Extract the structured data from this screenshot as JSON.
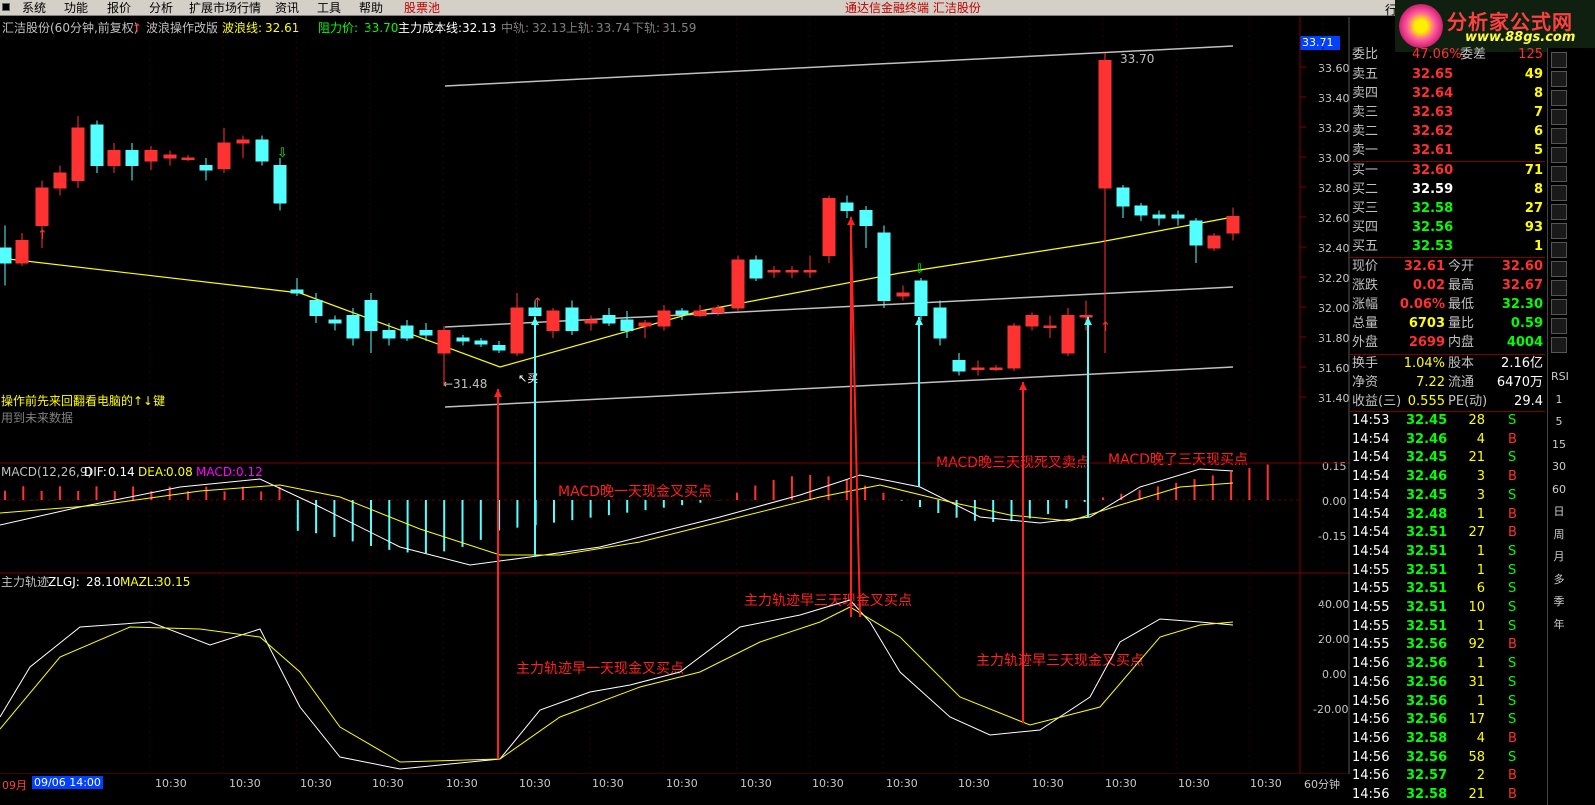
{
  "menu": [
    "系统",
    "功能",
    "报价",
    "分析",
    "扩展市场行情",
    "资讯",
    "工具",
    "帮助",
    "股票池"
  ],
  "menu_center_title": "通达信金融终端   汇洁股份",
  "menu_right": "行",
  "logo": {
    "text": "分析家公式网",
    "url": "www.88gs.com"
  },
  "header": {
    "title": "汇洁股份(60分钟,前复权)",
    "indicator": "波浪操作改版",
    "wave_label": "波浪线:",
    "wave_val": "32.61",
    "resist_label": "阻力价:",
    "resist_val": "33.70",
    "cost_label": "主力成本线:",
    "cost_val": "32.13",
    "mid_label": "中轨:",
    "mid_val": "32.13",
    "upper_label": "上轨:",
    "upper_val": "33.74",
    "lower_label": "下轨:",
    "lower_val": "31.59"
  },
  "price_scale": [
    "33.60",
    "33.40",
    "33.20",
    "33.00",
    "32.80",
    "32.60",
    "32.40",
    "32.20",
    "32.00",
    "31.80",
    "31.60",
    "31.40"
  ],
  "price_highlight": "33.71",
  "price_labels": {
    "high": "33.70",
    "low": "←31.48",
    "buy_mark": "↖买"
  },
  "notes": {
    "line1": "操作前先来回翻看电脑的↑↓键",
    "line2": "用到未来数据"
  },
  "macd": {
    "title": "MACD(12,26,9)",
    "dif_label": "DIF:",
    "dif": "0.14",
    "dea_label": "DEA:",
    "dea": "0.08",
    "macd_label": "MACD:",
    "macd": "0.12",
    "scale": [
      "0.15",
      "0.00",
      "-0.15"
    ],
    "ann1": "MACD晚一天现金叉买点",
    "ann2": "MACD晚三天现死叉卖点",
    "ann3": "MACD晚了三天现买点"
  },
  "zlgj": {
    "title": "主力轨迹",
    "zlgj_label": "ZLGJ:",
    "zlgj": "28.10",
    "mazl_label": "MAZL:",
    "mazl": "30.15",
    "scale": [
      "40.00",
      "20.00",
      "0.00",
      "-20.00"
    ],
    "ann1": "主力轨迹早一天现金叉买点",
    "ann2": "主力轨迹早三天现金叉买点",
    "ann3": "主力轨迹早三天现金叉买点"
  },
  "time_axis": {
    "first": "09月",
    "cursor": "09/06 14:00",
    "ticks": [
      "10:30",
      "10:30",
      "10:30",
      "10:30",
      "10:30",
      "10:30",
      "10:30",
      "10:30",
      "10:30",
      "10:30",
      "10:30",
      "10:30",
      "10:30",
      "10:30",
      "10:30",
      "10:30"
    ],
    "period": "60分钟"
  },
  "quote": {
    "top": {
      "label": "委比",
      "val": "47.06%",
      "label2": "委差",
      "val2": "125"
    },
    "asks": [
      {
        "label": "卖五",
        "price": "32.65",
        "vol": "49"
      },
      {
        "label": "卖四",
        "price": "32.64",
        "vol": "8"
      },
      {
        "label": "卖三",
        "price": "32.63",
        "vol": "7"
      },
      {
        "label": "卖二",
        "price": "32.62",
        "vol": "6"
      },
      {
        "label": "卖一",
        "price": "32.61",
        "vol": "5"
      }
    ],
    "bids": [
      {
        "label": "买一",
        "price": "32.60",
        "vol": "71"
      },
      {
        "label": "买二",
        "price": "32.59",
        "vol": "8"
      },
      {
        "label": "买三",
        "price": "32.58",
        "vol": "27"
      },
      {
        "label": "买四",
        "price": "32.56",
        "vol": "93"
      },
      {
        "label": "买五",
        "price": "32.53",
        "vol": "1"
      }
    ],
    "stats": [
      {
        "l1": "现价",
        "v1": "32.61",
        "l2": "今开",
        "v2": "32.60"
      },
      {
        "l1": "涨跌",
        "v1": "0.02",
        "l2": "最高",
        "v2": "32.67"
      },
      {
        "l1": "涨幅",
        "v1": "0.06%",
        "l2": "最低",
        "v2": "32.30"
      },
      {
        "l1": "总量",
        "v1": "6703",
        "l2": "量比",
        "v2": "0.59"
      },
      {
        "l1": "外盘",
        "v1": "2699",
        "l2": "内盘",
        "v2": "4004"
      }
    ],
    "stats2": [
      {
        "l1": "换手",
        "v1": "1.04%",
        "l2": "股本",
        "v2": "2.16亿"
      },
      {
        "l1": "净资",
        "v1": "7.22",
        "l2": "流通",
        "v2": "6470万"
      },
      {
        "l1": "收益(三)",
        "v1": "0.555",
        "l2": "PE(动)",
        "v2": "29.4"
      }
    ],
    "ticks": [
      {
        "t": "14:53",
        "p": "32.45",
        "v": "28",
        "s": "S"
      },
      {
        "t": "14:54",
        "p": "32.46",
        "v": "4",
        "s": "B"
      },
      {
        "t": "14:54",
        "p": "32.45",
        "v": "21",
        "s": "S"
      },
      {
        "t": "14:54",
        "p": "32.46",
        "v": "3",
        "s": "B"
      },
      {
        "t": "14:54",
        "p": "32.45",
        "v": "3",
        "s": "S"
      },
      {
        "t": "14:54",
        "p": "32.48",
        "v": "1",
        "s": "B"
      },
      {
        "t": "14:54",
        "p": "32.51",
        "v": "27",
        "s": "B"
      },
      {
        "t": "14:54",
        "p": "32.51",
        "v": "1",
        "s": "S"
      },
      {
        "t": "14:55",
        "p": "32.51",
        "v": "1",
        "s": "S"
      },
      {
        "t": "14:55",
        "p": "32.51",
        "v": "6",
        "s": "S"
      },
      {
        "t": "14:55",
        "p": "32.51",
        "v": "10",
        "s": "S"
      },
      {
        "t": "14:55",
        "p": "32.51",
        "v": "1",
        "s": "S"
      },
      {
        "t": "14:55",
        "p": "32.56",
        "v": "92",
        "s": "B"
      },
      {
        "t": "14:56",
        "p": "32.56",
        "v": "1",
        "s": "S"
      },
      {
        "t": "14:56",
        "p": "32.56",
        "v": "31",
        "s": "S"
      },
      {
        "t": "14:56",
        "p": "32.56",
        "v": "1",
        "s": "S"
      },
      {
        "t": "14:56",
        "p": "32.56",
        "v": "17",
        "s": "S"
      },
      {
        "t": "14:56",
        "p": "32.58",
        "v": "4",
        "s": "B"
      },
      {
        "t": "14:56",
        "p": "32.56",
        "v": "58",
        "s": "S"
      },
      {
        "t": "14:56",
        "p": "32.57",
        "v": "2",
        "s": "B"
      },
      {
        "t": "14:56",
        "p": "32.58",
        "v": "21",
        "s": "B"
      }
    ]
  },
  "sidebar": {
    "labels": [
      "RSI",
      "1",
      "5",
      "15",
      "30",
      "60",
      "日",
      "周",
      "月",
      "多",
      "季",
      "年"
    ]
  },
  "colors": {
    "up": "#ff3232",
    "down": "#54ffff",
    "wave": "#ffff00",
    "channel": "#c0c0c0",
    "grid": "#800000",
    "macd_line": "#ffffff",
    "dea_line": "#ffff00"
  }
}
